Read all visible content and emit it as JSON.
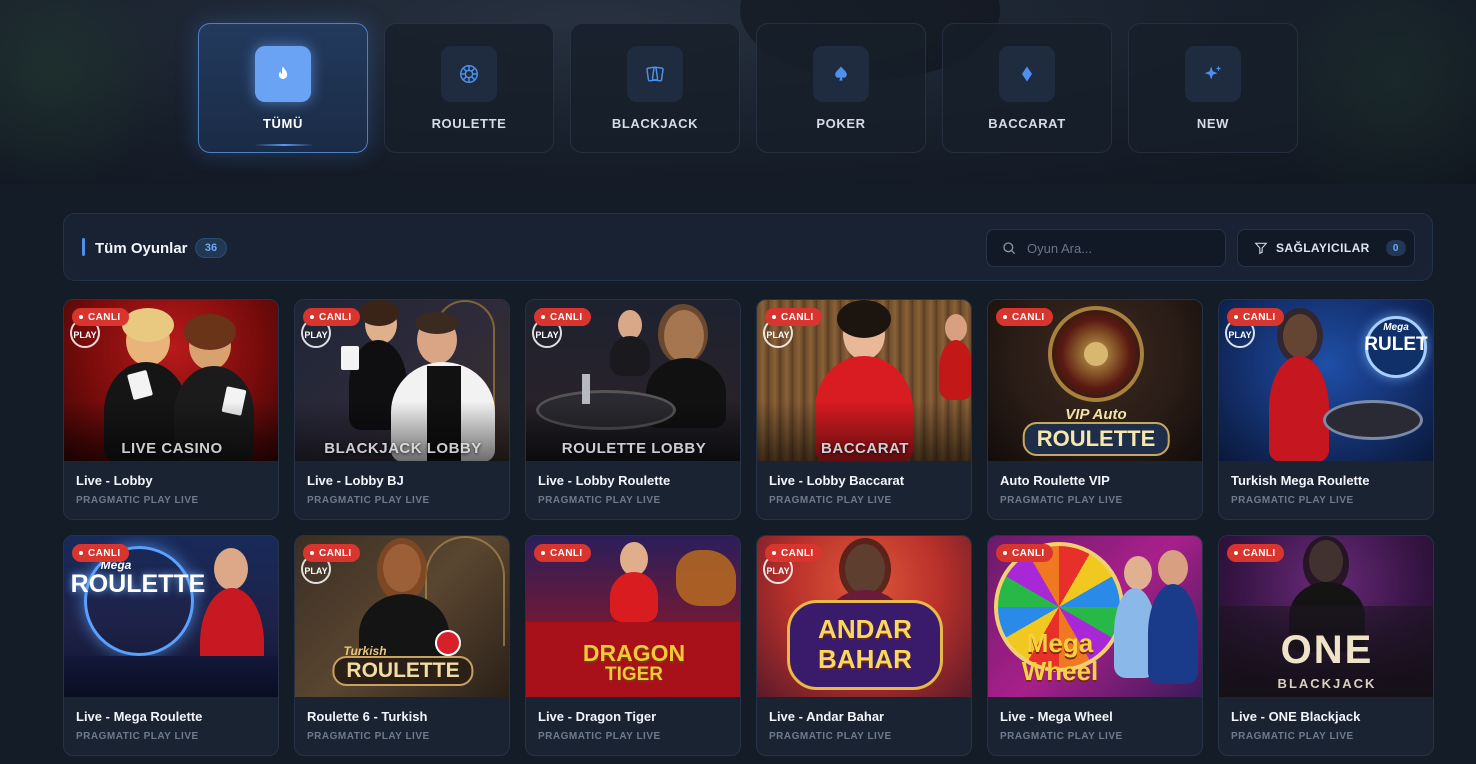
{
  "categories": [
    {
      "label": "TÜMÜ",
      "icon": "fire-icon",
      "active": true
    },
    {
      "label": "ROULETTE",
      "icon": "roulette-wheel-icon",
      "active": false
    },
    {
      "label": "BLACKJACK",
      "icon": "cards-icon",
      "active": false
    },
    {
      "label": "POKER",
      "icon": "spade-icon",
      "active": false
    },
    {
      "label": "BACCARAT",
      "icon": "diamond-icon",
      "active": false
    },
    {
      "label": "NEW",
      "icon": "sparkle-icon",
      "active": false
    }
  ],
  "toolbar": {
    "title": "Tüm Oyunlar",
    "count": "36",
    "search_placeholder": "Oyun Ara...",
    "providers_label": "SAĞLAYICILAR",
    "providers_count": "0"
  },
  "badge_label": "CANLI",
  "colors": {
    "accent": "#4f8fea",
    "badge": "#d8352f",
    "background": "#141c28",
    "card": "#1a2332"
  },
  "games": [
    {
      "name": "Live - Lobby",
      "provider": "PRAGMATIC PLAY LIVE",
      "caption": "LIVE CASINO",
      "play_ring": "PLAY"
    },
    {
      "name": "Live - Lobby BJ",
      "provider": "PRAGMATIC PLAY LIVE",
      "caption": "BLACKJACK LOBBY",
      "play_ring": "PLAY"
    },
    {
      "name": "Live - Lobby Roulette",
      "provider": "PRAGMATIC PLAY LIVE",
      "caption": "ROULETTE LOBBY",
      "play_ring": "PLAY"
    },
    {
      "name": "Live - Lobby Baccarat",
      "provider": "PRAGMATIC PLAY LIVE",
      "caption": "BACCARAT",
      "play_ring": "PLAY"
    },
    {
      "name": "Auto Roulette VIP",
      "provider": "PRAGMATIC PLAY LIVE",
      "logo_small": "VIP Auto",
      "logo": "ROULETTE"
    },
    {
      "name": "Turkish Mega Roulette",
      "provider": "PRAGMATIC PLAY LIVE",
      "play_ring": "PLAY",
      "logo_small": "Mega",
      "logo": "RULET"
    },
    {
      "name": "Live - Mega Roulette",
      "provider": "PRAGMATIC PLAY LIVE",
      "logo_small": "Mega",
      "logo": "ROULETTE"
    },
    {
      "name": "Roulette 6 - Turkish",
      "provider": "PRAGMATIC PLAY LIVE",
      "play_ring": "PLAY",
      "logo_small": "Turkish",
      "logo": "ROULETTE"
    },
    {
      "name": "Live - Dragon Tiger",
      "provider": "PRAGMATIC PLAY LIVE",
      "logo": "DRAGON",
      "logo_line2": "TIGER"
    },
    {
      "name": "Live - Andar Bahar",
      "provider": "PRAGMATIC PLAY LIVE",
      "play_ring": "PLAY",
      "logo": "ANDAR",
      "logo_line2": "BAHAR"
    },
    {
      "name": "Live - Mega Wheel",
      "provider": "PRAGMATIC PLAY LIVE",
      "logo": "Mega",
      "logo_line2": "Wheel"
    },
    {
      "name": "Live - ONE Blackjack",
      "provider": "PRAGMATIC PLAY LIVE",
      "logo": "ONE",
      "logo_line2": "BLACKJACK"
    }
  ]
}
